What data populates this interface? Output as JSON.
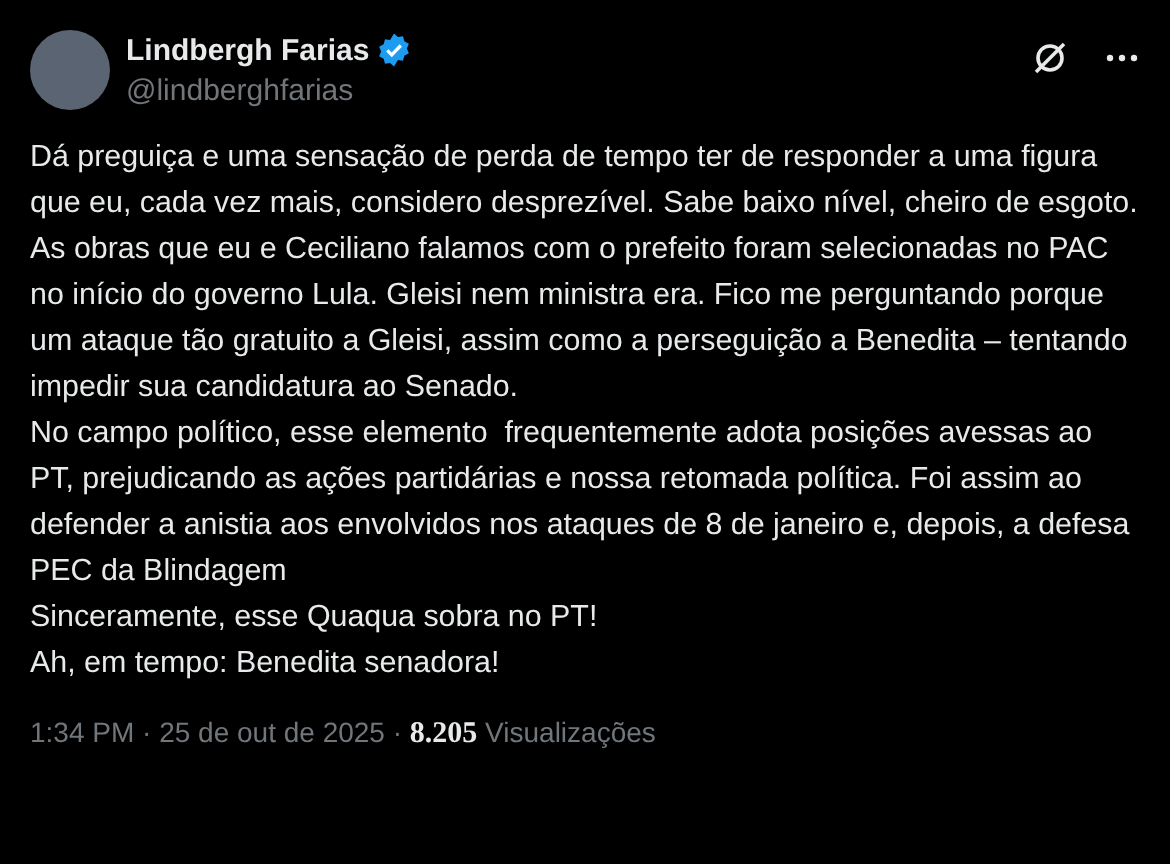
{
  "author": {
    "name": "Lindbergh Farias",
    "verified": true,
    "handle": "@lindberghfarias"
  },
  "paragraphs": [
    "Dá preguiça e uma sensação de perda de tempo ter de responder a uma figura que eu, cada vez mais, considero desprezível. Sabe baixo nível, cheiro de esgoto. As obras que eu e Ceciliano falamos com o prefeito foram selecionadas no PAC no início do governo Lula. Gleisi nem ministra era. Fico me perguntando porque um ataque tão gratuito a Gleisi, assim como a perseguição a Benedita – tentando impedir sua candidatura ao Senado.",
    "No campo político, esse elemento  frequentemente adota posições avessas ao PT, prejudicando as ações partidárias e nossa retomada política. Foi assim ao defender a anistia aos envolvidos nos ataques de 8 de janeiro e, depois, a defesa PEC da Blindagem",
    "Sinceramente, esse Quaqua sobra no PT!",
    "Ah, em tempo: Benedita senadora!"
  ],
  "footer": "1:34 PM · 25 de out de 2025 · **8.205** Visualizações"
}
